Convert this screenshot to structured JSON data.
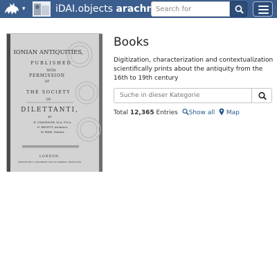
{
  "header": {
    "brand_caret": "▾",
    "title_prefix": "iDAI.objects ",
    "title_strong": "arachne",
    "search_placeholder": "Search for",
    "accent_color": "#3c5e8e"
  },
  "category": {
    "title": "Books",
    "description": "Digitization, characterization and contextualization scientifically prints about the antiquity from the 16th to 19th century",
    "search_placeholder": "Suche in dieser Kategorie",
    "total_label": "Total",
    "total_count": "12,365",
    "total_suffix": "Entries",
    "show_all": "Show all",
    "map": "Map"
  },
  "thumbnail": {
    "lines": [
      "IONIAN ANTIQUITIES,",
      "PUBLISHED",
      "WITH",
      "PERMISSION",
      "OF",
      "THE SOCIETY",
      "OF",
      "DILETTANTI,",
      "BY",
      "R. CHANDLER, M.A. F.S.A.",
      "N. REVETT, Architect,",
      "W. PARS, Painter.",
      "LONDON,",
      "PRINTED BY T. SPILSBURY AND W. HASKELL, MDCCLXIX."
    ]
  }
}
